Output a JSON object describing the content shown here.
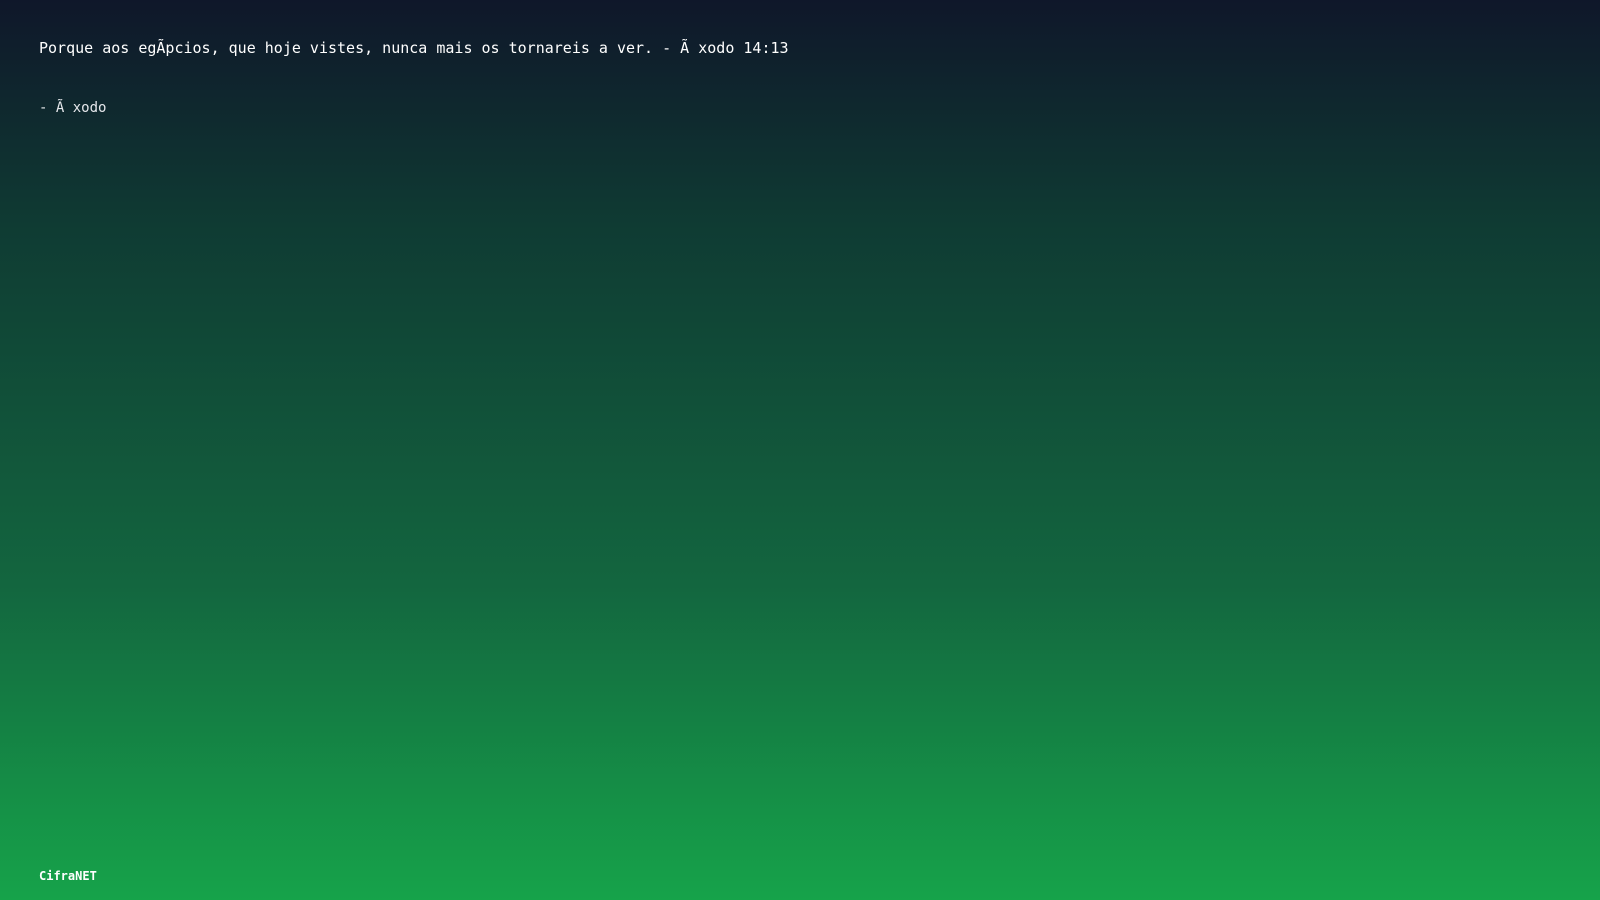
{
  "slide": {
    "verse_text": "Porque aos egÃ­pcios, que hoje vistes, nunca mais os tornareis a ver. - Ã xodo 14:13",
    "source_text": "- Ã xodo"
  },
  "footer": {
    "brand": "CifraNET"
  }
}
